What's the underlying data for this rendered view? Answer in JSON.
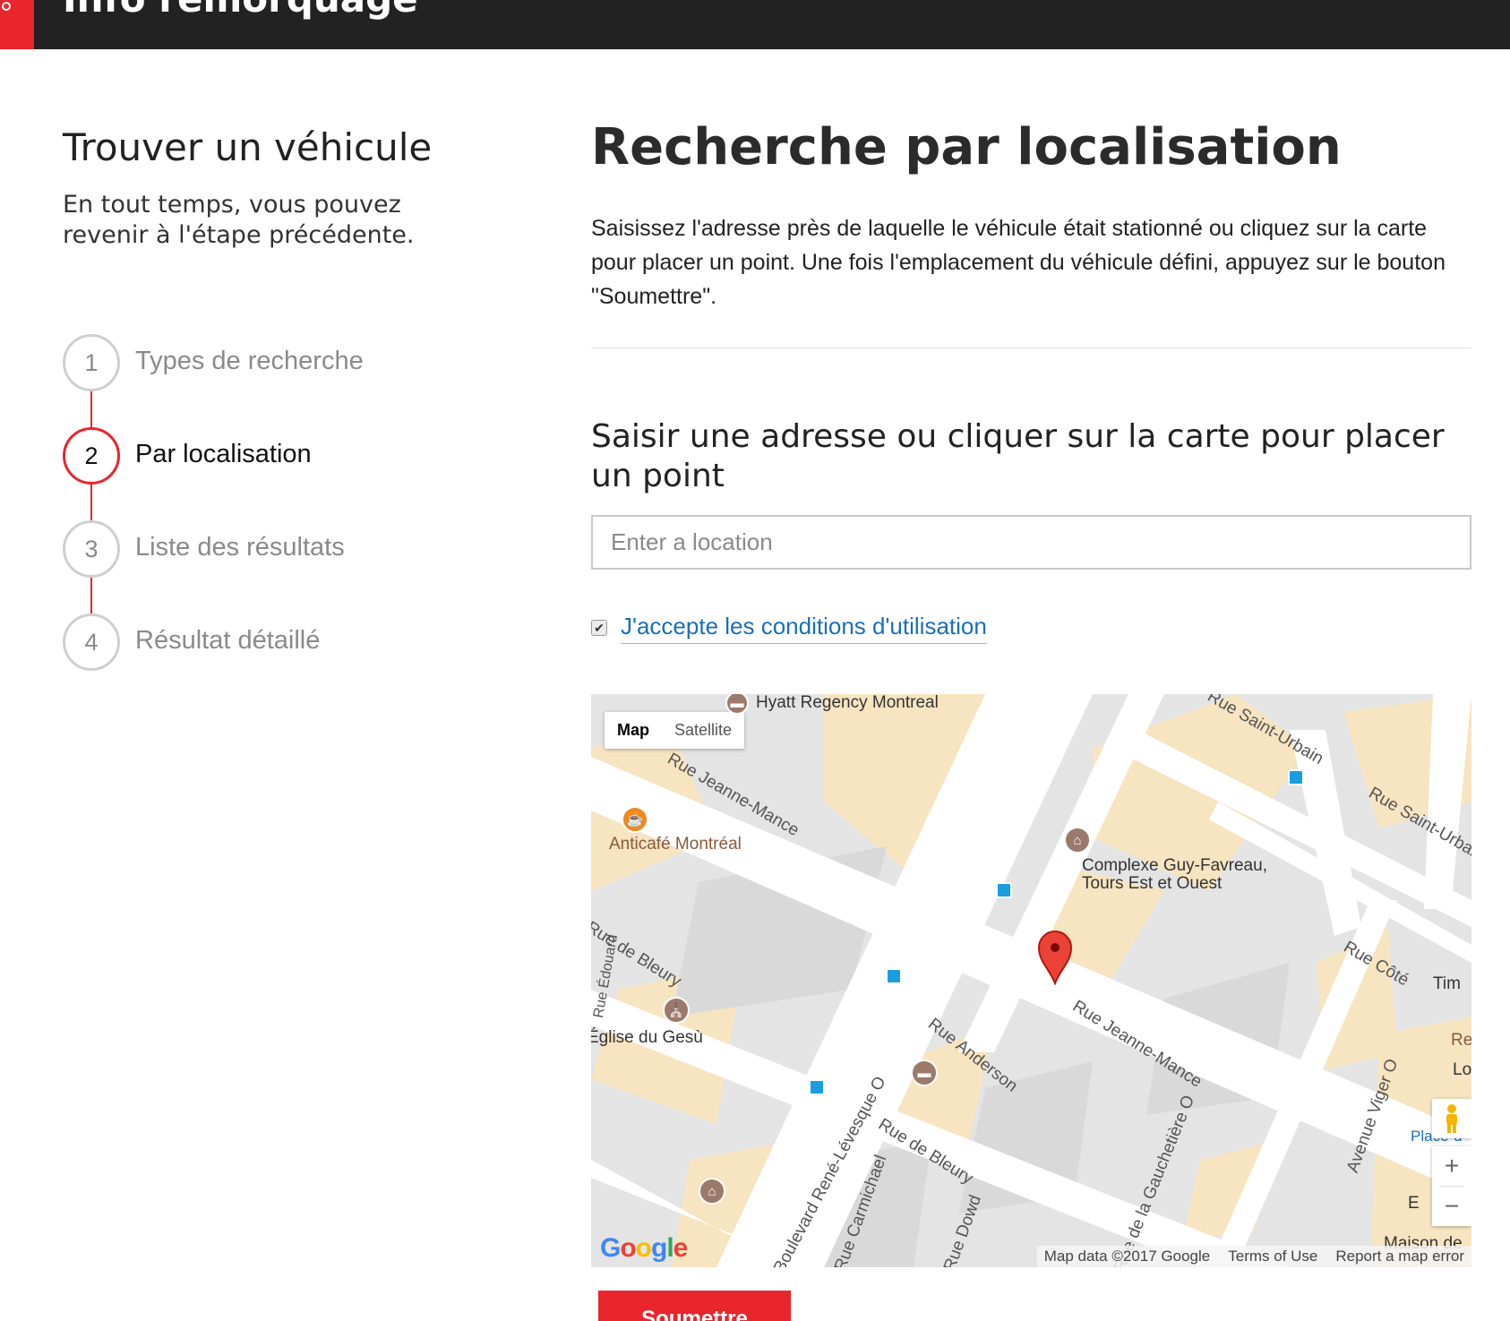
{
  "header": {
    "title": "Info remorquage"
  },
  "sidebar": {
    "title": "Trouver un véhicule",
    "intro": "En tout temps, vous pouvez revenir à l'étape précédente.",
    "steps": [
      {
        "number": "1",
        "label": "Types de recherche"
      },
      {
        "number": "2",
        "label": "Par localisation"
      },
      {
        "number": "3",
        "label": "Liste des résultats"
      },
      {
        "number": "4",
        "label": "Résultat détaillé"
      }
    ],
    "active_step": 2
  },
  "main": {
    "title": "Recherche par localisation",
    "description": "Saisissez l'adresse près de laquelle le véhicule était stationné ou cliquez sur la carte pour placer un point. Une fois l'emplacement du véhicule défini, appuyez sur le bouton \"Soumettre\".",
    "address_heading": "Saisir une adresse ou cliquer sur la carte pour placer un point",
    "location_input": {
      "placeholder": "Enter a location",
      "value": ""
    },
    "terms": {
      "checked": true,
      "label": "J'accepte les conditions d'utilisation"
    },
    "submit_label": "Soumettre"
  },
  "map": {
    "type_buttons": {
      "map": "Map",
      "satellite": "Satellite"
    },
    "places": {
      "hyatt": "Hyatt Regency Montreal",
      "anticafe": "Anticafé Montréal",
      "complexe_1": "Complexe Guy-Favreau,",
      "complexe_2": "Tours Est et Ouest",
      "gesu": "Église du Gesù",
      "tim": "Tim",
      "re": "Re",
      "lo": "Lo",
      "place": "Place-d'",
      "e": "E",
      "maison": "Maison de"
    },
    "streets": {
      "jeanne_mance_top": "Rue Jeanne-Mance",
      "jeanne_mance": "Rue Jeanne-Mance",
      "bleury_left": "Rue de Bleury",
      "bleury": "Rue de Bleury",
      "anderson": "Rue Anderson",
      "saint_urbain": "Rue Saint-Urbain",
      "saint_urbain_2": "Rue Saint-Urbain",
      "cote": "Rue Côté",
      "rene_levesque": "Boulevard René-Lévesque O",
      "carmichael": "Rue Carmichael",
      "gauchetiere": "Rue de la Gauchetière O",
      "viger": "Avenue Viger O",
      "dowd": "Rue Dowd",
      "edward": "Rue Édouard"
    },
    "attribution": {
      "data": "Map data ©2017 Google",
      "terms": "Terms of Use",
      "report": "Report a map error"
    },
    "logo_letters": [
      "G",
      "o",
      "o",
      "g",
      "l",
      "e"
    ],
    "colors": {
      "road": "#ffffff",
      "block": "#e0e0e0",
      "building_highlight": "#f7e4c0",
      "pin": "#ea4335",
      "bus": "#1a9ee0"
    }
  },
  "colors": {
    "accent": "#e8262c",
    "link": "#1a6fb5",
    "header_bg": "#222222"
  }
}
